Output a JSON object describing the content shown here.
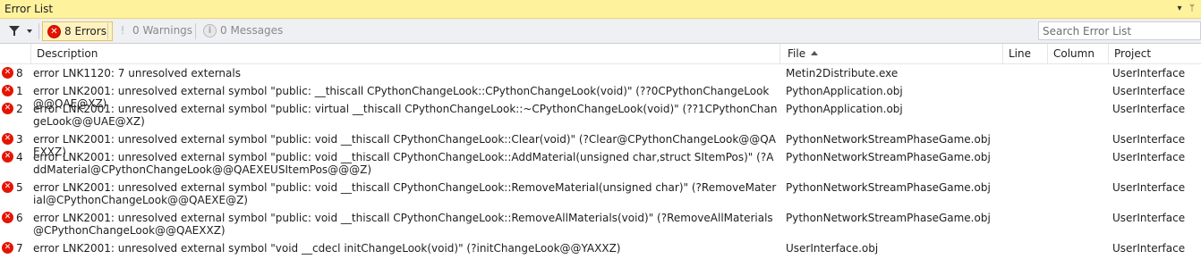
{
  "window": {
    "title": "Error List"
  },
  "toolbar": {
    "errors_label": "8 Errors",
    "warnings_label": "0 Warnings",
    "messages_label": "0 Messages",
    "search_placeholder": "Search Error List"
  },
  "columns": {
    "description": "Description",
    "file": "File",
    "line": "Line",
    "column": "Column",
    "project": "Project"
  },
  "rows": [
    {
      "num": "8",
      "description": "error LNK1120: 7 unresolved externals",
      "file": "Metin2Distribute.exe",
      "line": "",
      "column": "",
      "project": "UserInterface"
    },
    {
      "num": "1",
      "description": "error LNK2001: unresolved external symbol \"public: __thiscall CPythonChangeLook::CPythonChangeLook(void)\" (??0CPythonChangeLook@@QAE@XZ)",
      "file": "PythonApplication.obj",
      "line": "",
      "column": "",
      "project": "UserInterface"
    },
    {
      "num": "2",
      "description": "error LNK2001: unresolved external symbol \"public: virtual __thiscall CPythonChangeLook::~CPythonChangeLook(void)\" (??1CPythonChangeLook@@UAE@XZ)",
      "file": "PythonApplication.obj",
      "line": "",
      "column": "",
      "project": "UserInterface"
    },
    {
      "num": "3",
      "description": "error LNK2001: unresolved external symbol \"public: void __thiscall CPythonChangeLook::Clear(void)\" (?Clear@CPythonChangeLook@@QAEXXZ)",
      "file": "PythonNetworkStreamPhaseGame.obj",
      "line": "",
      "column": "",
      "project": "UserInterface"
    },
    {
      "num": "4",
      "description": "error LNK2001: unresolved external symbol \"public: void __thiscall CPythonChangeLook::AddMaterial(unsigned char,struct SItemPos)\" (?AddMaterial@CPythonChangeLook@@QAEXEUSItemPos@@@Z)",
      "file": "PythonNetworkStreamPhaseGame.obj",
      "line": "",
      "column": "",
      "project": "UserInterface"
    },
    {
      "num": "5",
      "description": "error LNK2001: unresolved external symbol \"public: void __thiscall CPythonChangeLook::RemoveMaterial(unsigned char)\" (?RemoveMaterial@CPythonChangeLook@@QAEXE@Z)",
      "file": "PythonNetworkStreamPhaseGame.obj",
      "line": "",
      "column": "",
      "project": "UserInterface"
    },
    {
      "num": "6",
      "description": "error LNK2001: unresolved external symbol \"public: void __thiscall CPythonChangeLook::RemoveAllMaterials(void)\" (?RemoveAllMaterials@CPythonChangeLook@@QAEXXZ)",
      "file": "PythonNetworkStreamPhaseGame.obj",
      "line": "",
      "column": "",
      "project": "UserInterface"
    },
    {
      "num": "7",
      "description": "error LNK2001: unresolved external symbol \"void __cdecl initChangeLook(void)\" (?initChangeLook@@YAXXZ)",
      "file": "UserInterface.obj",
      "line": "",
      "column": "",
      "project": "UserInterface"
    }
  ],
  "colors": {
    "title_bg": "#fff29d",
    "error_red": "#e51400",
    "active_toggle": "#fff2bf"
  },
  "icons": {
    "filter": "filter-icon",
    "error": "error-icon",
    "warning": "warning-icon",
    "message": "info-icon"
  }
}
